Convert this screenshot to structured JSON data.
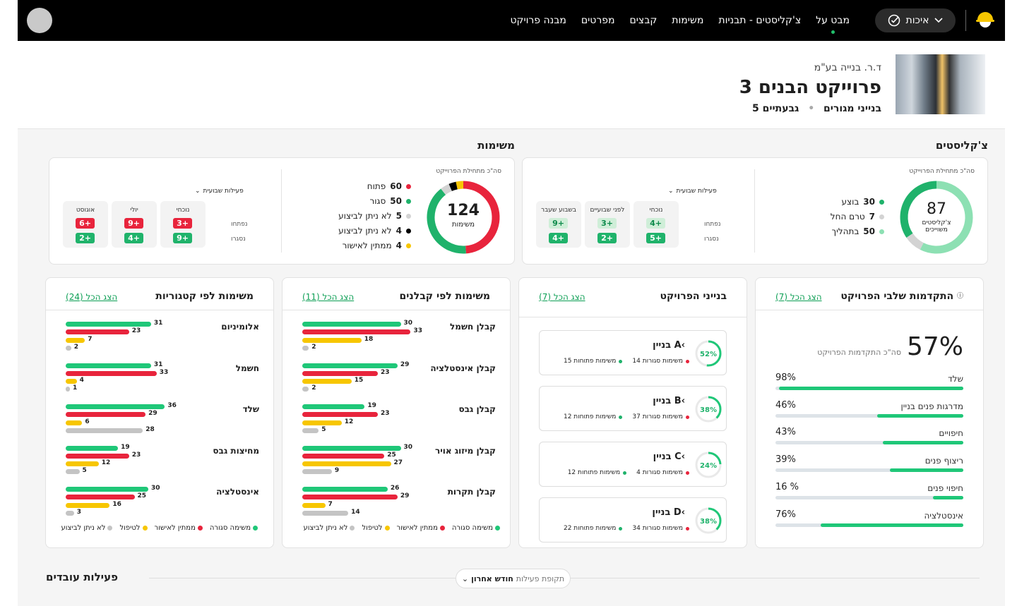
{
  "nav": {
    "items": [
      "מבט על",
      "צ'קליסטים - תבניות",
      "משימות",
      "קבצים",
      "מפרטים",
      "מבנה פרויקט"
    ],
    "quality_label": "איכות"
  },
  "project": {
    "company": "ד.ר. בנייה בע\"מ",
    "title": "פרוייקט הבנים 3",
    "buildings": "5 בנייני מגורים",
    "city": "גבעתיים"
  },
  "checklists": {
    "title": "צ'קליסטים",
    "since_label": "סה\"כ מתחילת הפרוייקט",
    "total": "87",
    "total_label": "צ'קליסטים משוייכים",
    "legend": [
      {
        "value": "30",
        "label": "בוצע",
        "color": "#1fb26b"
      },
      {
        "value": "7",
        "label": "טרם החל",
        "color": "#d3d3d3"
      },
      {
        "value": "50",
        "label": "בתהליך",
        "color": "#8de0b3"
      }
    ],
    "weekly_label": "פעילות שבועית",
    "row_labels": [
      "נפתחו",
      "נסגרו"
    ],
    "weeks": [
      {
        "label": "נוכחי",
        "top": "4+",
        "bottom": "5+"
      },
      {
        "label": "לפני שבועיים",
        "top": "3+",
        "bottom": "2+"
      },
      {
        "label": "בשבוע שעבר",
        "top": "9+",
        "bottom": "4+"
      }
    ]
  },
  "tasks": {
    "title": "משימות",
    "since_label": "סה\"כ מתחילת הפרוייקט",
    "total": "124",
    "total_label": "משימות",
    "legend": [
      {
        "value": "60",
        "label": "פתוח",
        "color": "#e8243c"
      },
      {
        "value": "50",
        "label": "סגור",
        "color": "#1fb26b"
      },
      {
        "value": "5",
        "label": "לא ניתן לביצוע",
        "color": "#d3d3d3"
      },
      {
        "value": "4",
        "label": "לא ניתן לביצוע",
        "color": "#000000"
      },
      {
        "value": "4",
        "label": "ממתין לאישור",
        "color": "#f7c600"
      }
    ],
    "weekly_label": "פעילות שבועית",
    "row_labels": [
      "נפתחו",
      "נסגרו"
    ],
    "weeks": [
      {
        "label": "נוכחי",
        "top": "3+",
        "bottom": "9+"
      },
      {
        "label": "יולי",
        "top": "9+",
        "bottom": "4+"
      },
      {
        "label": "אוגוסט",
        "top": "6+",
        "bottom": "2+"
      }
    ]
  },
  "progress": {
    "title": "התקדמות שלבי הפרויקט",
    "show_all": "הצג הכל (7)",
    "percent": "57%",
    "percent_label": "סה\"כ התקדמות הפרויקט",
    "stages": [
      {
        "name": "שלד",
        "percent": "98%",
        "value": 0.98
      },
      {
        "name": "מדרגות פנים בניין",
        "percent": "46%",
        "value": 0.46
      },
      {
        "name": "חיפויים",
        "percent": "43%",
        "value": 0.43
      },
      {
        "name": "ריצוף פנים",
        "percent": "39%",
        "value": 0.39
      },
      {
        "name": "חיפוי פנים",
        "percent": "16 %",
        "value": 0.16
      },
      {
        "name": "אינסטלציה",
        "percent": "76%",
        "value": 0.76
      }
    ]
  },
  "buildings": {
    "title": "בנייני הפרויקט",
    "show_all": "הצג הכל (7)",
    "items": [
      {
        "name": "בניין A",
        "percent": "52%",
        "value": 0.52,
        "closed": "14 משימות סגורות",
        "open": "15 משימות פתוחות"
      },
      {
        "name": "בניין B",
        "percent": "38%",
        "value": 0.38,
        "closed": "37 משימות סגורות",
        "open": "12 משימות פתוחות"
      },
      {
        "name": "בניין C",
        "percent": "24%",
        "value": 0.24,
        "closed": "4 משימות סגורות",
        "open": "12 משימות פתוחות"
      },
      {
        "name": "בניין D",
        "percent": "38%",
        "value": 0.38,
        "closed": "34 משימות סגורות",
        "open": "22 משימות פתוחות"
      }
    ]
  },
  "contractors": {
    "title": "משימות לפי קבלנים",
    "show_all": "הצג הכל (11)",
    "rows": [
      {
        "label": "קבלן חשמל",
        "values": [
          30,
          33,
          18,
          2
        ]
      },
      {
        "label": "קבלן אינסטלציה",
        "values": [
          29,
          23,
          15,
          2
        ]
      },
      {
        "label": "קבלן גבס",
        "values": [
          19,
          23,
          12,
          5
        ]
      },
      {
        "label": "קבלן מיזוג אויר",
        "values": [
          30,
          25,
          27,
          9
        ]
      },
      {
        "label": "קבלן תקרות",
        "values": [
          26,
          29,
          7,
          14
        ]
      }
    ],
    "legend": [
      "משימה סגורה",
      "ממתין לאישור",
      "לטיפול",
      "לא ניתן לביצוע"
    ]
  },
  "categories": {
    "title": "משימות לפי קטגוריות",
    "show_all": "הצג הכל (24)",
    "rows": [
      {
        "label": "אלומיניום",
        "values": [
          31,
          23,
          7,
          2
        ]
      },
      {
        "label": "חשמל",
        "values": [
          31,
          33,
          4,
          1
        ]
      },
      {
        "label": "שלד",
        "values": [
          36,
          29,
          6,
          28
        ]
      },
      {
        "label": "מחיצות גבס",
        "values": [
          19,
          23,
          12,
          5
        ]
      },
      {
        "label": "אינסטלציה",
        "values": [
          30,
          25,
          16,
          3
        ]
      }
    ],
    "legend": [
      "משימה סגורה",
      "ממתין לאישור",
      "לטיפול",
      "לא ניתן לביצוע"
    ]
  },
  "bar_colors": [
    "#1fc778",
    "#e8243c",
    "#f7c600",
    "#c4c4c4"
  ],
  "activity": {
    "title": "פעילות עובדים",
    "period_label": "תקופת פעילות",
    "period_value": "חודש אחרון"
  }
}
